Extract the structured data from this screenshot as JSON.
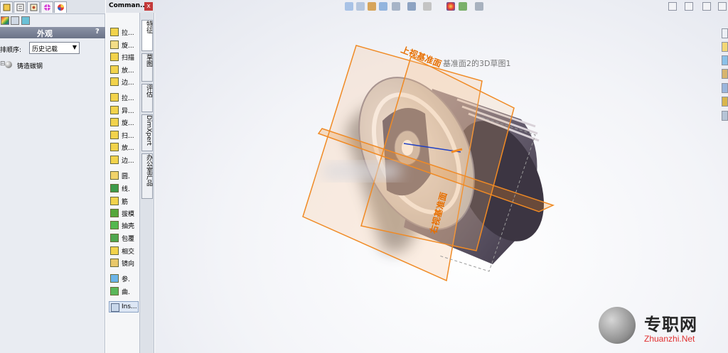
{
  "feature_manager": {
    "appearance_title": "外观",
    "help_symbol": "?",
    "sort_label": "排顺序:",
    "sort_value": "历史记载",
    "tree_expander": "⊟",
    "material_name": "铸造碳钢"
  },
  "command_manager": {
    "title": "Comman...",
    "close_symbol": "x",
    "items": [
      {
        "label": "拉..."
      },
      {
        "label": "旋..."
      },
      {
        "label": "扫描"
      },
      {
        "label": "放..."
      },
      {
        "label": "边..."
      },
      {
        "label": "拉..."
      },
      {
        "label": "异..."
      },
      {
        "label": "旋..."
      },
      {
        "label": "扫..."
      },
      {
        "label": "放..."
      },
      {
        "label": "边..."
      },
      {
        "label": "圆."
      },
      {
        "label": "线."
      },
      {
        "label": "筋"
      },
      {
        "label": "拔模"
      },
      {
        "label": "抽壳"
      },
      {
        "label": "包覆"
      },
      {
        "label": "相交"
      },
      {
        "label": "镜向"
      },
      {
        "label": "参."
      },
      {
        "label": "曲."
      }
    ],
    "instant3d_label": "Ins..."
  },
  "vertical_tabs": [
    {
      "label": "特征"
    },
    {
      "label": "草图"
    },
    {
      "label": "评估"
    },
    {
      "label": "DimXpert"
    },
    {
      "label": "办公室产品"
    }
  ],
  "viewport": {
    "plane_label_top": "上视基准面",
    "plane_label_right": "右视基准面",
    "sketch_label": "基准面2的3D草图1",
    "colors": {
      "plane": "#f08a24",
      "plane_fill": "#f6c18e",
      "piston_light": "#d2cbc8",
      "piston_dark": "#5d5665",
      "pin": "#b9b2ad"
    }
  },
  "watermark": {
    "name": "专职网",
    "url": "Zhuanzhi.Net"
  }
}
